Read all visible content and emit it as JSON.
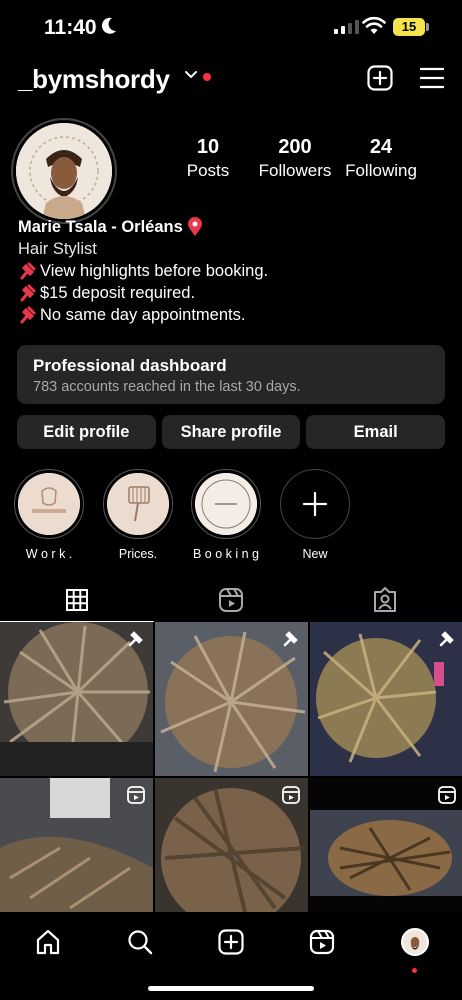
{
  "status_bar": {
    "time": "11:40",
    "battery": "15"
  },
  "header": {
    "username": "_bymshordy"
  },
  "stats": [
    {
      "number": "10",
      "label": "Posts"
    },
    {
      "number": "200",
      "label": "Followers"
    },
    {
      "number": "24",
      "label": "Following"
    }
  ],
  "bio": {
    "name": "Marie Tsala - Orléans",
    "category": "Hair Stylist",
    "lines": [
      "View highlights before booking.",
      "$15 deposit required.",
      "No same day appointments."
    ]
  },
  "dashboard": {
    "title": "Professional dashboard",
    "subtitle": "783 accounts reached in the last 30 days."
  },
  "actions": {
    "edit": "Edit profile",
    "share": "Share profile",
    "email": "Email"
  },
  "highlights": [
    {
      "label": "W o r k ."
    },
    {
      "label": "Prices."
    },
    {
      "label": "B o o k i n g"
    },
    {
      "label": "New"
    }
  ],
  "colors": {
    "accent_red": "#ff3040",
    "surface": "#262626",
    "muted": "#a8a8a8"
  }
}
